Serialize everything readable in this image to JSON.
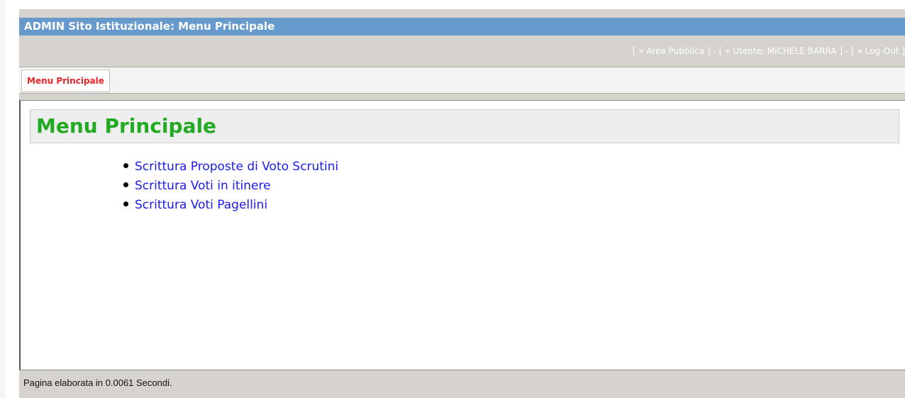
{
  "header": {
    "title": "ADMIN Sito Istituzionale: Menu Principale"
  },
  "user_bar": {
    "open_bracket": "[ ",
    "close_bracket": " ]",
    "dash": " - ",
    "public_area": "» Area Pubblica",
    "user": "» Utente: MICHELE BARRA",
    "logout": "» Log-Out"
  },
  "menu": {
    "tabs": [
      {
        "label": "Menu Principale"
      }
    ]
  },
  "main": {
    "heading": "Menu Principale",
    "items": [
      {
        "label": "Scrittura Proposte di Voto Scrutini"
      },
      {
        "label": "Scrittura Voti in itinere"
      },
      {
        "label": "Scrittura Voti Pagellini"
      }
    ]
  },
  "footer": {
    "status": "Pagina elaborata in 0.0061 Secondi."
  },
  "colors": {
    "title_bar": "#6699cc",
    "heading_text": "#22aa22",
    "link": "#1a1aee",
    "tab_text": "#ee2222",
    "frame": "#d6d3ce"
  }
}
